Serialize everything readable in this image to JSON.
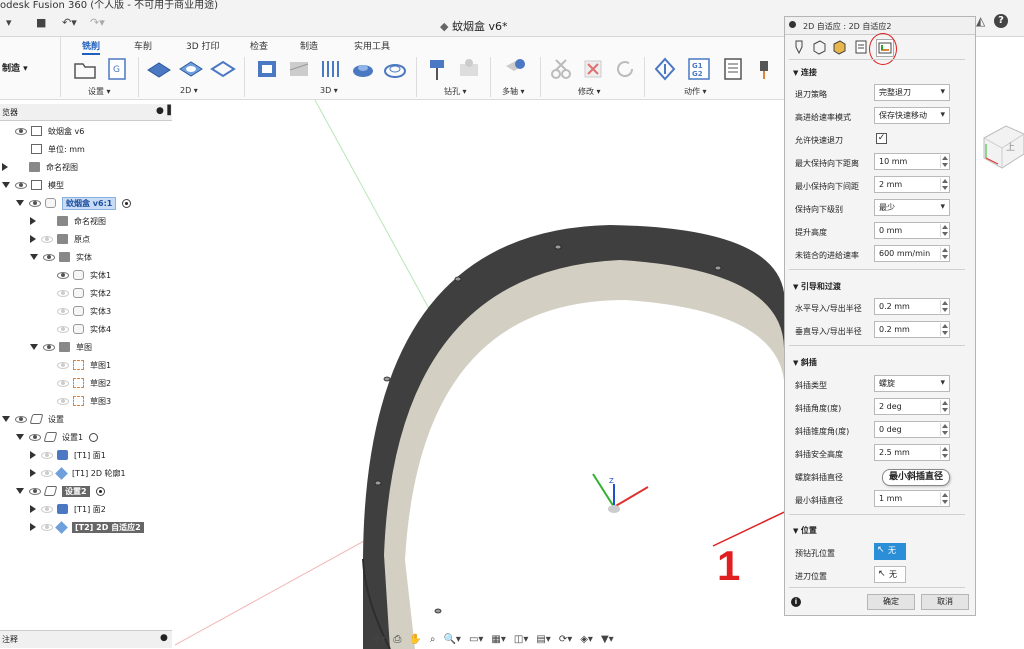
{
  "app": {
    "title": "odesk Fusion 360 (个人版 - 不可用于商业用途)",
    "doc_tab": "蚊烟盒 v6*",
    "help": "?"
  },
  "workspace_tabs": [
    "铣削",
    "车削",
    "3D 打印",
    "检查",
    "制造",
    "实用工具"
  ],
  "workspace_select": "制造 ▾",
  "toolbar_groups": [
    {
      "label": "设置 ▾"
    },
    {
      "label": "2D ▾"
    },
    {
      "label": "3D ▾"
    },
    {
      "label": "钻孔 ▾"
    },
    {
      "label": "多轴 ▾"
    },
    {
      "label": "修改 ▾"
    },
    {
      "label": "动作 ▾"
    }
  ],
  "browser": {
    "header": "览器",
    "footer": "注释",
    "rows": [
      {
        "indent": 0,
        "tri": "",
        "eye": true,
        "icon": "doc",
        "label": "蚊烟盒 v6",
        "style": ""
      },
      {
        "indent": 0,
        "tri": "",
        "eye": false,
        "icon": "doc",
        "label": "单位: mm",
        "style": ""
      },
      {
        "indent": 0,
        "tri": "closed",
        "eye": false,
        "icon": "folder",
        "label": "命名视图",
        "style": ""
      },
      {
        "indent": 0,
        "tri": "open",
        "eye": true,
        "icon": "doc",
        "label": "模型",
        "style": ""
      },
      {
        "indent": 1,
        "tri": "open",
        "eye": true,
        "icon": "body",
        "label": "蚊烟盒 v6:1",
        "style": "hl",
        "radio": "on"
      },
      {
        "indent": 2,
        "tri": "closed",
        "eye": false,
        "icon": "folder",
        "label": "命名视图",
        "style": ""
      },
      {
        "indent": 2,
        "tri": "closed",
        "eye": "dim",
        "icon": "folder",
        "label": "原点",
        "style": ""
      },
      {
        "indent": 2,
        "tri": "open",
        "eye": true,
        "icon": "folder",
        "label": "实体",
        "style": ""
      },
      {
        "indent": 3,
        "tri": "",
        "eye": true,
        "icon": "body",
        "label": "实体1",
        "style": ""
      },
      {
        "indent": 3,
        "tri": "",
        "eye": "dim",
        "icon": "body",
        "label": "实体2",
        "style": ""
      },
      {
        "indent": 3,
        "tri": "",
        "eye": "dim",
        "icon": "body",
        "label": "实体3",
        "style": ""
      },
      {
        "indent": 3,
        "tri": "",
        "eye": "dim",
        "icon": "body",
        "label": "实体4",
        "style": ""
      },
      {
        "indent": 2,
        "tri": "open",
        "eye": true,
        "icon": "folder",
        "label": "草图",
        "style": ""
      },
      {
        "indent": 3,
        "tri": "",
        "eye": "dim",
        "icon": "sketch",
        "label": "草图1",
        "style": ""
      },
      {
        "indent": 3,
        "tri": "",
        "eye": "dim",
        "icon": "sketch",
        "label": "草图2",
        "style": ""
      },
      {
        "indent": 3,
        "tri": "",
        "eye": "dim",
        "icon": "sketch",
        "label": "草图3",
        "style": ""
      },
      {
        "indent": 0,
        "tri": "open",
        "eye": true,
        "icon": "setup",
        "label": "设置",
        "style": ""
      },
      {
        "indent": 1,
        "tri": "open",
        "eye": true,
        "icon": "setup",
        "label": "设置1",
        "style": "",
        "radio": "off"
      },
      {
        "indent": 2,
        "tri": "closed",
        "eye": "dim",
        "icon": "op",
        "label": "[T1] 面1",
        "style": ""
      },
      {
        "indent": 2,
        "tri": "closed",
        "eye": "dim",
        "icon": "op2",
        "label": "[T1] 2D 轮廓1",
        "style": ""
      },
      {
        "indent": 1,
        "tri": "open",
        "eye": true,
        "icon": "setup",
        "label": "设置2",
        "style": "hl-dark",
        "radio": "on"
      },
      {
        "indent": 2,
        "tri": "closed",
        "eye": "dim",
        "icon": "op",
        "label": "[T1] 面2",
        "style": ""
      },
      {
        "indent": 2,
        "tri": "closed",
        "eye": "dim",
        "icon": "op2",
        "label": "[T2] 2D 自适应2",
        "style": "hl-dark"
      }
    ]
  },
  "panel": {
    "title": "2D 自适应 : 2D 自适应2",
    "sections": {
      "linking": "连接",
      "leads": "引导和过渡",
      "ramp": "斜插",
      "positions": "位置"
    },
    "fields": {
      "retract_policy": {
        "label": "退刀策略",
        "value": "完整退刀"
      },
      "high_feed": {
        "label": "高进给速率模式",
        "value": "保存快速移动"
      },
      "allow_rapid": {
        "label": "允许快速退刀",
        "value": "✓"
      },
      "max_stay_down": {
        "label": "最大保持向下距离",
        "value": "10 mm"
      },
      "min_stay_down": {
        "label": "最小保持向下间距",
        "value": "2 mm"
      },
      "keep_down": {
        "label": "保持向下级别",
        "value": "最少"
      },
      "lift_height": {
        "label": "提升高度",
        "value": "0 mm"
      },
      "unlinked_feed": {
        "label": "未链合的进给速率",
        "value": "600 mm/min"
      },
      "lead_radius_h": {
        "label": "水平导入/导出半径",
        "value": "0.2 mm"
      },
      "lead_radius_v": {
        "label": "垂直导入/导出半径",
        "value": "0.2 mm"
      },
      "ramp_type": {
        "label": "斜插类型",
        "value": "螺旋"
      },
      "ramp_angle": {
        "label": "斜插角度(度)",
        "value": "2 deg"
      },
      "ramp_taper": {
        "label": "斜插锥度角(度)",
        "value": "0 deg"
      },
      "ramp_clearance": {
        "label": "斜插安全高度",
        "value": "2.5 mm"
      },
      "helix_diam": {
        "label": "螺旋斜插直径",
        "tooltip": "最小斜插直径"
      },
      "min_ramp_diam": {
        "label": "最小斜插直径",
        "value": "1 mm"
      },
      "drill_pos": {
        "label": "预钻孔位置",
        "value": "无"
      },
      "entry_pos": {
        "label": "进刀位置",
        "value": "无"
      }
    },
    "info": "i",
    "ok": "确定",
    "cancel": "取消"
  },
  "annotation": {
    "number": "1",
    "color": "#e02020"
  },
  "nav_bar": [
    "✥▾",
    "⎙",
    "✋",
    "⌕",
    "🔍▾",
    "▭▾",
    "▦▾",
    "◫▾",
    "▤▾",
    "⟳▾",
    "◈▾",
    "▼▾"
  ],
  "colors": {
    "accent": "#1e5fbf",
    "ring": "#4a4a4a",
    "ring_inner": "#d3cfc3",
    "annotation": "#e02020"
  }
}
